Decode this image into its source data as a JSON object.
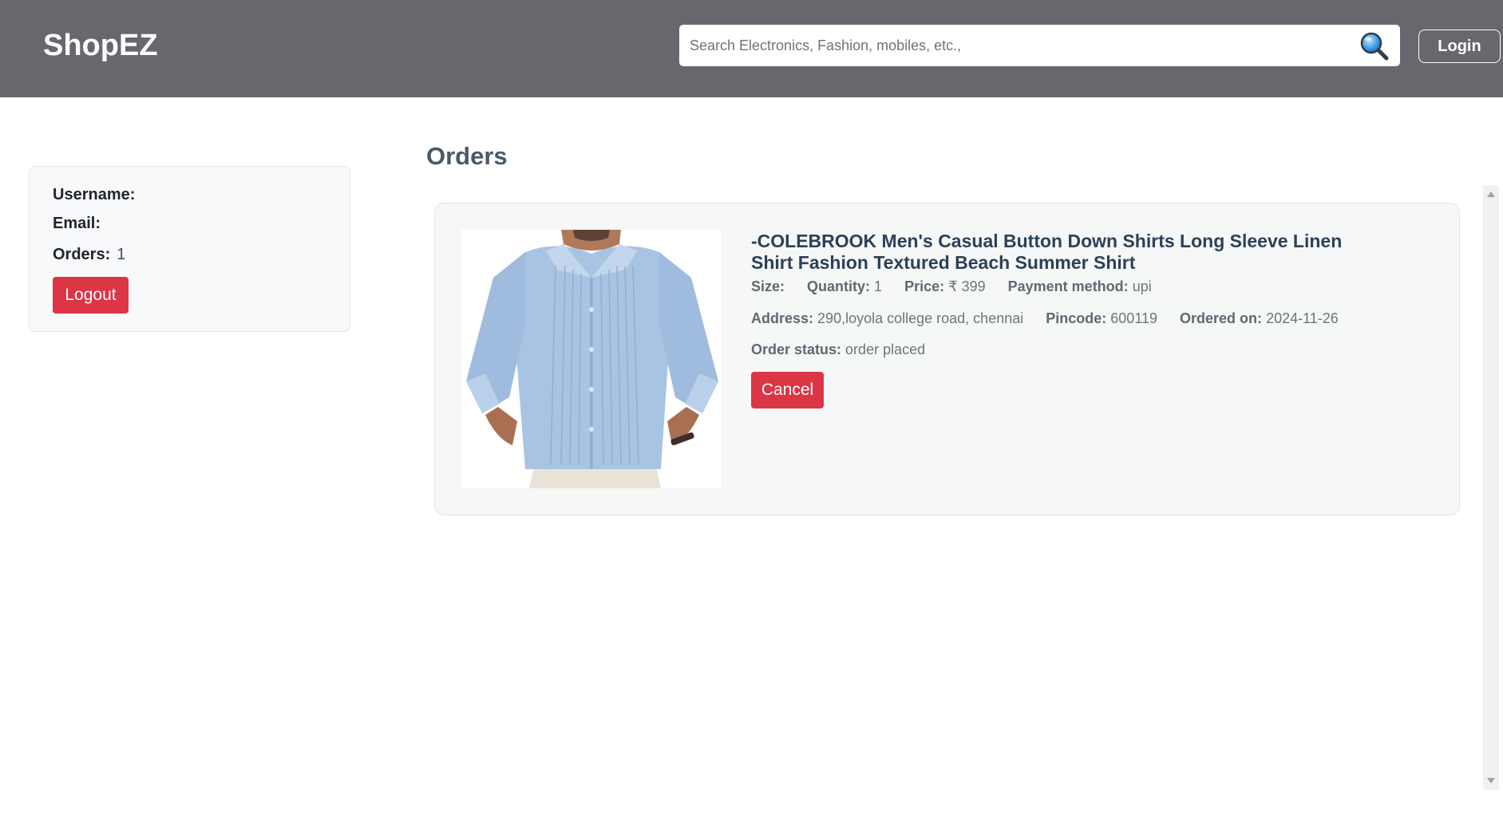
{
  "header": {
    "brand": "ShopEZ",
    "search_placeholder": "Search Electronics, Fashion, mobiles, etc.,",
    "search_icon": "search-icon",
    "login_label": "Login"
  },
  "profile": {
    "username_label": "Username:",
    "username_value": "",
    "email_label": "Email:",
    "email_value": "",
    "orders_label": "Orders:",
    "orders_value": "1",
    "logout_label": "Logout"
  },
  "orders": {
    "title": "Orders",
    "items": [
      {
        "product_title": "-COLEBROOK Men's Casual Button Down Shirts Long Sleeve Linen Shirt Fashion Textured Beach Summer Shirt",
        "size_label": "Size:",
        "size_value": "",
        "quantity_label": "Quantity:",
        "quantity_value": "1",
        "price_label": "Price:",
        "price_value": "₹ 399",
        "payment_label": "Payment method:",
        "payment_value": "upi",
        "address_label": "Address:",
        "address_value": "290,loyola college road, chennai",
        "pincode_label": "Pincode:",
        "pincode_value": "600119",
        "ordered_on_label": "Ordered on:",
        "ordered_on_value": "2024-11-26",
        "status_label": "Order status:",
        "status_value": "order placed",
        "cancel_label": "Cancel"
      }
    ]
  },
  "colors": {
    "navbar": "#68676d",
    "danger": "#dc3545",
    "card_bg": "#f6f7f7",
    "title": "#2c4159"
  }
}
